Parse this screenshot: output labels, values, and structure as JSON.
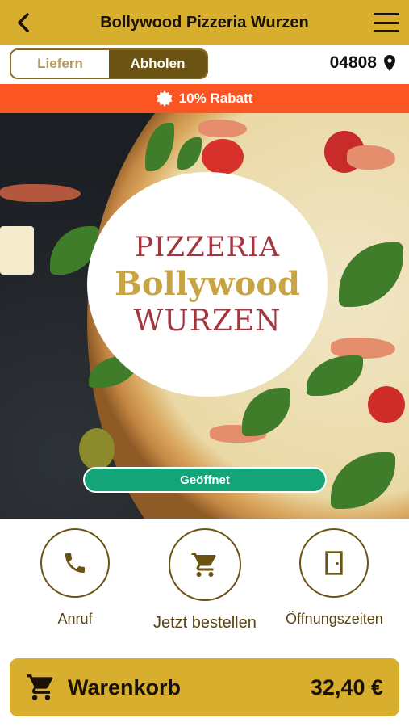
{
  "header": {
    "title": "Bollywood Pizzeria Wurzen",
    "back_icon": "chevron-left-icon",
    "menu_icon": "hamburger-menu-icon"
  },
  "mode_toggle": {
    "options": [
      "Liefern",
      "Abholen"
    ],
    "selected": "Abholen"
  },
  "location": {
    "zip": "04808",
    "icon": "location-pin-icon"
  },
  "discount": {
    "text": "10% Rabatt",
    "icon": "badge-icon"
  },
  "logo": {
    "line1": "PIZZERIA",
    "line2": "Bollywood",
    "line3": "WURZEN"
  },
  "status": {
    "label": "Geöffnet"
  },
  "actions": [
    {
      "label": "Anruf",
      "icon": "phone-icon"
    },
    {
      "label": "Jetzt bestellen",
      "icon": "cart-icon"
    },
    {
      "label": "Öffnungszeiten",
      "icon": "door-icon"
    }
  ],
  "cart": {
    "label": "Warenkorb",
    "total": "32,40 €",
    "icon": "cart-icon"
  },
  "colors": {
    "brand": "#d8ae2f",
    "brand_dark": "#6b5314",
    "discount": "#fa5522",
    "status_open": "#13a577",
    "logo_red": "#a3373f",
    "logo_gold": "#c9a444"
  }
}
